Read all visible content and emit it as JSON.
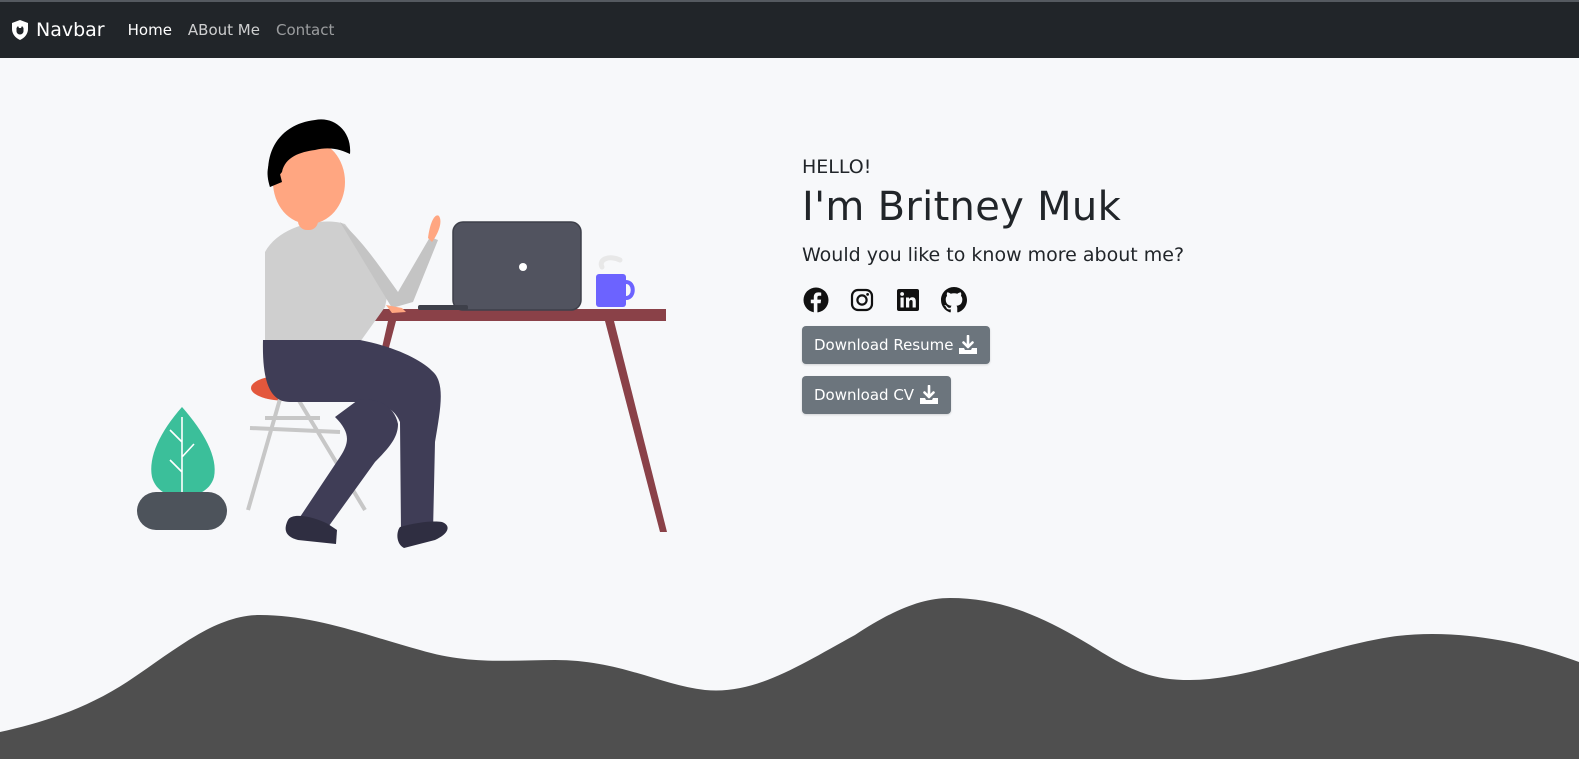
{
  "navbar": {
    "brand": "Navbar",
    "links": [
      {
        "label": "Home",
        "state": "active"
      },
      {
        "label": "ABout Me",
        "state": "normal"
      },
      {
        "label": "Contact",
        "state": "muted"
      }
    ]
  },
  "hero": {
    "greeting": "HELLO!",
    "name": "I'm Britney Muk",
    "tagline": "Would you like to know more about me?",
    "socials": [
      "facebook-icon",
      "instagram-icon",
      "linkedin-icon",
      "github-icon"
    ],
    "buttons": {
      "resume": "Download Resume",
      "cv": "Download CV"
    }
  },
  "colors": {
    "navbar_bg": "#212529",
    "page_bg": "#f7f8fa",
    "button_bg": "#6c757d",
    "wave": "#4f4f4f"
  }
}
